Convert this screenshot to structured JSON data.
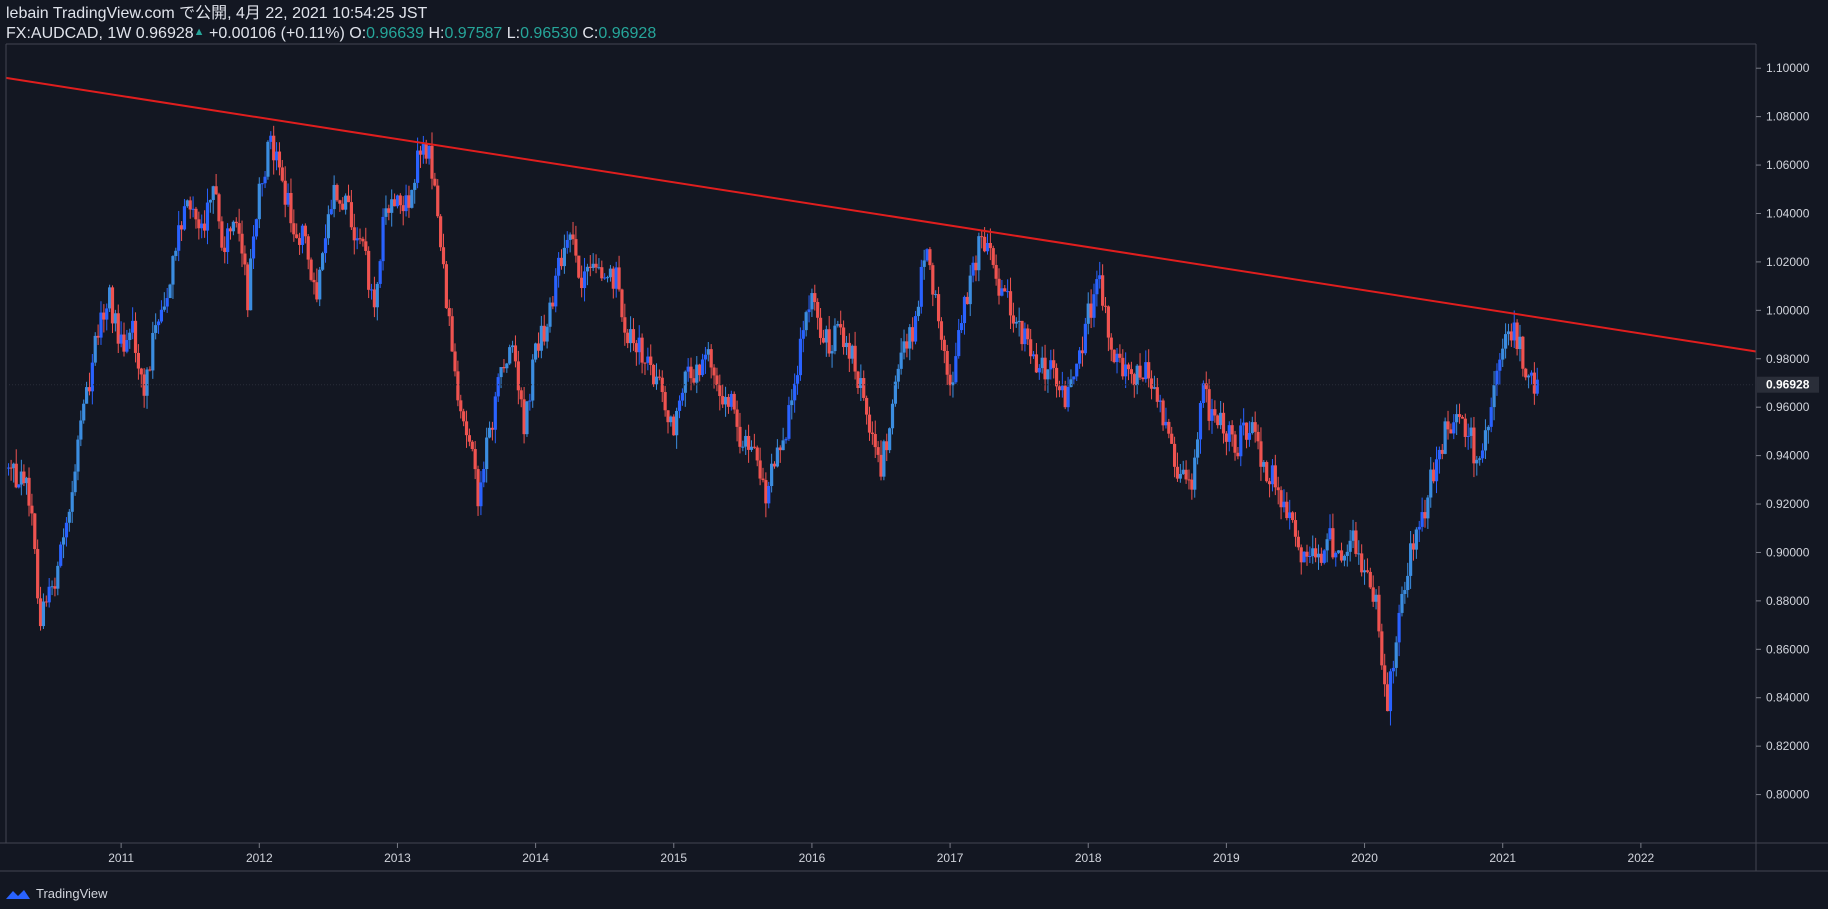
{
  "header": {
    "publisher": "lebain TradingView.com で公開, 4月 22, 2021 10:54:25 JST",
    "symbol": "FX:AUDCAD, 1W",
    "last": "0.96928",
    "change": "+0.00106 (+0.11%)",
    "o_label": "O:",
    "o_value": "0.96639",
    "h_label": "H:",
    "h_value": "0.97587",
    "l_label": "L:",
    "l_value": "0.96530",
    "c_label": "C:",
    "c_value": "0.96928"
  },
  "footer": {
    "brand": "TradingView"
  },
  "colors": {
    "background": "#131722",
    "up": "#2962ff",
    "up_light": "#3b8de0",
    "down": "#ef5350",
    "trendline": "#e01e1e",
    "axis_text": "#d1d4dc",
    "price_tag": "#2a2e39"
  },
  "chart_data": {
    "type": "candlestick",
    "symbol": "FX:AUDCAD",
    "interval": "1W",
    "ylim": [
      0.78,
      1.11
    ],
    "y_ticks": [
      "1.10000",
      "1.08000",
      "1.06000",
      "1.04000",
      "1.02000",
      "1.00000",
      "0.98000",
      "0.96000",
      "0.94000",
      "0.92000",
      "0.90000",
      "0.88000",
      "0.86000",
      "0.84000",
      "0.82000",
      "0.80000"
    ],
    "x_ticks": [
      "2011",
      "2012",
      "2013",
      "2014",
      "2015",
      "2016",
      "2017",
      "2018",
      "2019",
      "2020",
      "2021",
      "2022"
    ],
    "xlim": [
      "2010-03",
      "2022-11"
    ],
    "current_price": "0.96928",
    "grid": false,
    "trendline": {
      "from": {
        "x": "2010-03",
        "y": 1.096
      },
      "to": {
        "x": "2022-11",
        "y": 0.983
      }
    },
    "path": [
      [
        "2010-03",
        0.935
      ],
      [
        "2010-05",
        0.925
      ],
      [
        "2010-06",
        0.872
      ],
      [
        "2010-07",
        0.885
      ],
      [
        "2010-08",
        0.905
      ],
      [
        "2010-09",
        0.935
      ],
      [
        "2010-10",
        0.965
      ],
      [
        "2010-11",
        0.99
      ],
      [
        "2010-12",
        1.005
      ],
      [
        "2011-01",
        0.985
      ],
      [
        "2011-02",
        0.995
      ],
      [
        "2011-03",
        0.965
      ],
      [
        "2011-04",
        0.995
      ],
      [
        "2011-05",
        1.01
      ],
      [
        "2011-06",
        1.035
      ],
      [
        "2011-07",
        1.045
      ],
      [
        "2011-08",
        1.03
      ],
      [
        "2011-09",
        1.05
      ],
      [
        "2011-10",
        1.025
      ],
      [
        "2011-11",
        1.04
      ],
      [
        "2011-12",
        1.005
      ],
      [
        "2012-01",
        1.05
      ],
      [
        "2012-02",
        1.07
      ],
      [
        "2012-03",
        1.05
      ],
      [
        "2012-04",
        1.035
      ],
      [
        "2012-05",
        1.03
      ],
      [
        "2012-06",
        1.0
      ],
      [
        "2012-07",
        1.045
      ],
      [
        "2012-08",
        1.05
      ],
      [
        "2012-09",
        1.035
      ],
      [
        "2012-10",
        1.025
      ],
      [
        "2012-11",
        1.0
      ],
      [
        "2012-12",
        1.045
      ],
      [
        "2013-01",
        1.05
      ],
      [
        "2013-02",
        1.04
      ],
      [
        "2013-03",
        1.068
      ],
      [
        "2013-04",
        1.06
      ],
      [
        "2013-05",
        1.015
      ],
      [
        "2013-06",
        0.975
      ],
      [
        "2013-07",
        0.95
      ],
      [
        "2013-08",
        0.925
      ],
      [
        "2013-09",
        0.95
      ],
      [
        "2013-10",
        0.975
      ],
      [
        "2013-11",
        0.99
      ],
      [
        "2013-12",
        0.95
      ],
      [
        "2014-01",
        0.985
      ],
      [
        "2014-02",
        0.995
      ],
      [
        "2014-03",
        1.02
      ],
      [
        "2014-04",
        1.03
      ],
      [
        "2014-05",
        1.01
      ],
      [
        "2014-06",
        1.015
      ],
      [
        "2014-07",
        1.01
      ],
      [
        "2014-08",
        1.015
      ],
      [
        "2014-09",
        0.99
      ],
      [
        "2014-10",
        0.985
      ],
      [
        "2014-11",
        0.975
      ],
      [
        "2014-12",
        0.965
      ],
      [
        "2015-01",
        0.95
      ],
      [
        "2015-02",
        0.97
      ],
      [
        "2015-03",
        0.975
      ],
      [
        "2015-04",
        0.98
      ],
      [
        "2015-05",
        0.965
      ],
      [
        "2015-06",
        0.96
      ],
      [
        "2015-07",
        0.945
      ],
      [
        "2015-08",
        0.94
      ],
      [
        "2015-09",
        0.925
      ],
      [
        "2015-10",
        0.945
      ],
      [
        "2015-11",
        0.955
      ],
      [
        "2015-12",
        0.985
      ],
      [
        "2016-01",
        1.005
      ],
      [
        "2016-02",
        0.985
      ],
      [
        "2016-03",
        0.99
      ],
      [
        "2016-04",
        0.99
      ],
      [
        "2016-05",
        0.97
      ],
      [
        "2016-06",
        0.955
      ],
      [
        "2016-07",
        0.935
      ],
      [
        "2016-08",
        0.96
      ],
      [
        "2016-09",
        0.985
      ],
      [
        "2016-10",
        0.995
      ],
      [
        "2016-11",
        1.03
      ],
      [
        "2016-12",
        0.995
      ],
      [
        "2017-01",
        0.97
      ],
      [
        "2017-02",
        0.995
      ],
      [
        "2017-03",
        1.02
      ],
      [
        "2017-04",
        1.03
      ],
      [
        "2017-05",
        1.01
      ],
      [
        "2017-06",
        1.005
      ],
      [
        "2017-07",
        0.99
      ],
      [
        "2017-08",
        0.985
      ],
      [
        "2017-09",
        0.975
      ],
      [
        "2017-10",
        0.975
      ],
      [
        "2017-11",
        0.965
      ],
      [
        "2017-12",
        0.975
      ],
      [
        "2018-01",
        1.0
      ],
      [
        "2018-02",
        1.01
      ],
      [
        "2018-03",
        0.985
      ],
      [
        "2018-04",
        0.975
      ],
      [
        "2018-05",
        0.97
      ],
      [
        "2018-06",
        0.975
      ],
      [
        "2018-07",
        0.965
      ],
      [
        "2018-08",
        0.95
      ],
      [
        "2018-09",
        0.93
      ],
      [
        "2018-10",
        0.93
      ],
      [
        "2018-11",
        0.965
      ],
      [
        "2018-12",
        0.955
      ],
      [
        "2019-01",
        0.95
      ],
      [
        "2019-02",
        0.945
      ],
      [
        "2019-03",
        0.955
      ],
      [
        "2019-04",
        0.94
      ],
      [
        "2019-05",
        0.93
      ],
      [
        "2019-06",
        0.92
      ],
      [
        "2019-07",
        0.905
      ],
      [
        "2019-08",
        0.895
      ],
      [
        "2019-09",
        0.9
      ],
      [
        "2019-10",
        0.905
      ],
      [
        "2019-11",
        0.9
      ],
      [
        "2019-12",
        0.91
      ],
      [
        "2020-01",
        0.89
      ],
      [
        "2020-02",
        0.88
      ],
      [
        "2020-03",
        0.835
      ],
      [
        "2020-04",
        0.875
      ],
      [
        "2020-05",
        0.9
      ],
      [
        "2020-06",
        0.915
      ],
      [
        "2020-07",
        0.935
      ],
      [
        "2020-08",
        0.95
      ],
      [
        "2020-09",
        0.96
      ],
      [
        "2020-10",
        0.95
      ],
      [
        "2020-11",
        0.935
      ],
      [
        "2020-12",
        0.96
      ],
      [
        "2021-01",
        0.985
      ],
      [
        "2021-02",
        0.995
      ],
      [
        "2021-03",
        0.975
      ],
      [
        "2021-04",
        0.969
      ]
    ]
  }
}
